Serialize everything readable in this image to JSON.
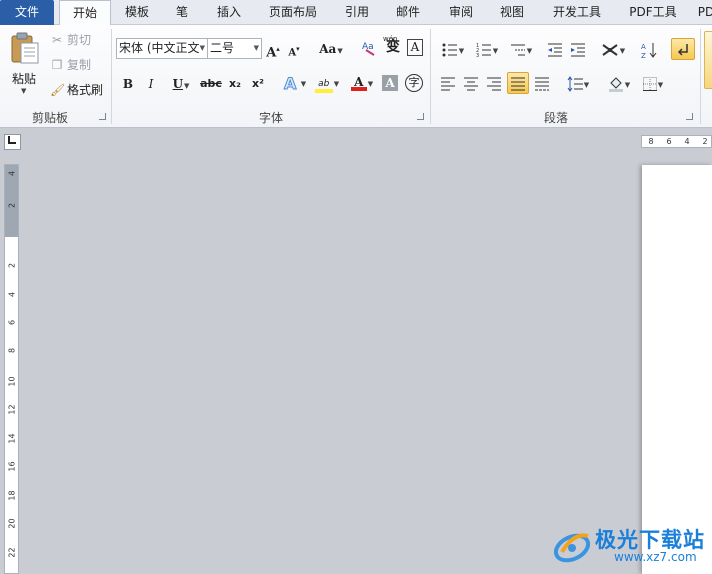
{
  "tabs": [
    "文件",
    "开始",
    "模板",
    "笔",
    "插入",
    "页面布局",
    "引用",
    "邮件",
    "审阅",
    "视图",
    "开发工具",
    "PDF工具",
    "PD"
  ],
  "clipboard": {
    "paste_label": "粘贴",
    "cut_label": "剪切",
    "copy_label": "复制",
    "format_painter_label": "格式刷",
    "group_label": "剪贴板"
  },
  "font": {
    "font_name": "宋体 (中文正文",
    "font_size": "二号",
    "grow_label": "A",
    "shrink_label": "A",
    "change_case_label": "Aa",
    "clear_format_label": "A",
    "bold_label": "B",
    "italic_label": "I",
    "underline_label": "U",
    "strike_label": "abc",
    "subscript_label": "x₂",
    "superscript_label": "x²",
    "highlight_label": "ab",
    "color_label": "A",
    "shade_label": "A",
    "enclose_label": "字",
    "phonetic_label": "变",
    "phonetic_top": "wén",
    "group_label": "字体"
  },
  "paragraph": {
    "group_label": "段落"
  },
  "ruler": {
    "h_ticks": [
      "8",
      "6",
      "4",
      "2"
    ],
    "v_ticks": [
      "4",
      "2",
      "2",
      "4",
      "6",
      "8",
      "10",
      "12",
      "14",
      "16",
      "18",
      "20",
      "22"
    ]
  },
  "watermark": {
    "text": "极光下载站",
    "url": "www.xz7.com"
  },
  "colors": {
    "file_tab": "#2a5ea7",
    "highlight_yellow": "#ffef3c",
    "font_red": "#e0201b",
    "selected_button": "#f7c750",
    "workspace": "#c9ccd2",
    "watermark_blue": "#1a7fd9"
  }
}
